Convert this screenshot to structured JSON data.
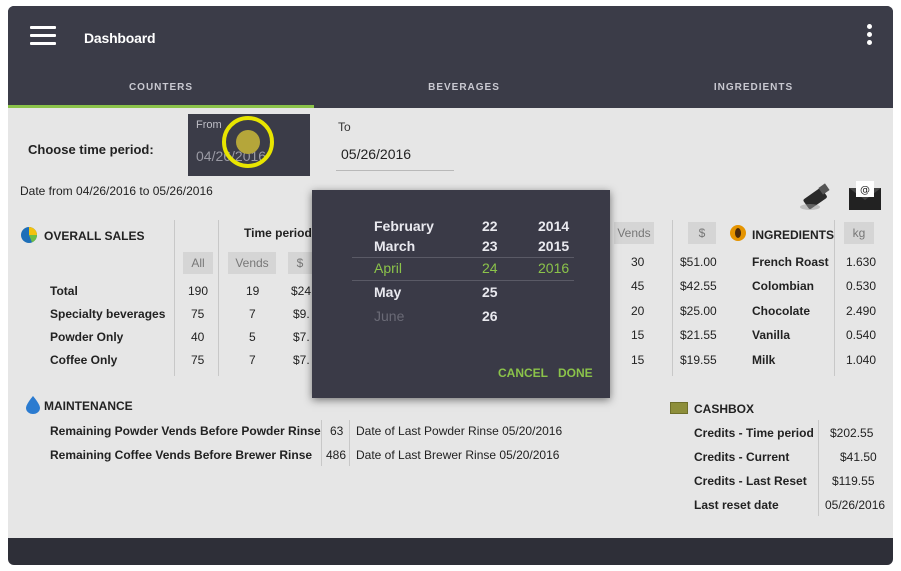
{
  "appbar": {
    "title": "Dashboard",
    "menu_icon": "hamburger-menu-icon",
    "overflow_icon": "more-vert-icon"
  },
  "tabs": [
    {
      "label": "COUNTERS",
      "active": true
    },
    {
      "label": "BEVERAGES",
      "active": false
    },
    {
      "label": "INGREDIENTS",
      "active": false
    }
  ],
  "time_period": {
    "label": "Choose time period:",
    "from_label": "From",
    "from_value": "04/26/2016",
    "to_label": "To",
    "to_value": "05/26/2016",
    "range_text": "Date from 04/26/2016 to 05/26/2016"
  },
  "colors": {
    "accent": "#8bc34a",
    "appbar": "#3b3c48",
    "touch_indicator": "#e8e500"
  },
  "sales": {
    "title": "OVERALL SALES",
    "time_period_header": "Time period",
    "col_all": "All",
    "col_vends": "Vends",
    "col_dollar": "$",
    "rows": [
      {
        "label": "Total",
        "all": "190",
        "vends": "19",
        "dollar": "$24"
      },
      {
        "label": "Specialty beverages",
        "all": "75",
        "vends": "7",
        "dollar": "$9."
      },
      {
        "label": "Powder Only",
        "all": "40",
        "vends": "5",
        "dollar": "$7."
      },
      {
        "label": "Coffee Only",
        "all": "75",
        "vends": "7",
        "dollar": "$7."
      }
    ]
  },
  "partial": {
    "col_vends": "Vends",
    "col_dollar": "$",
    "rows": [
      {
        "vends": "30",
        "dollar": "$51.00"
      },
      {
        "vends": "45",
        "dollar": "$42.55"
      },
      {
        "vends": "20",
        "dollar": "$25.00"
      },
      {
        "vends": "15",
        "dollar": "$21.55"
      },
      {
        "vends": "15",
        "dollar": "$19.55"
      }
    ]
  },
  "ingredients": {
    "title": "INGREDIENTS",
    "unit": "kg",
    "rows": [
      {
        "name": "French Roast",
        "kg": "1.630"
      },
      {
        "name": "Colombian",
        "kg": "0.530"
      },
      {
        "name": "Chocolate",
        "kg": "2.490"
      },
      {
        "name": "Vanilla",
        "kg": "0.540"
      },
      {
        "name": "Milk",
        "kg": "1.040"
      }
    ]
  },
  "maintenance": {
    "title": "MAINTENANCE",
    "rows": [
      {
        "label": "Remaining Powder Vends Before Powder Rinse",
        "value": "63",
        "note": "Date of Last Powder Rinse 05/20/2016"
      },
      {
        "label": "Remaining Coffee Vends Before Brewer Rinse",
        "value": "486",
        "note": "Date of Last Brewer Rinse 05/20/2016"
      }
    ]
  },
  "cashbox": {
    "title": "CASHBOX",
    "rows": [
      {
        "label": "Credits - Time period",
        "value": "$202.55"
      },
      {
        "label": "Credits - Current",
        "value": "$41.50"
      },
      {
        "label": "Credits - Last Reset",
        "value": "$119.55"
      },
      {
        "label": "Last reset date",
        "value": "05/26/2016"
      }
    ]
  },
  "date_picker": {
    "months": [
      "February",
      "March",
      "April",
      "May",
      "June"
    ],
    "days": [
      "22",
      "23",
      "24",
      "25",
      "26"
    ],
    "years": [
      "2014",
      "2015",
      "2016"
    ],
    "selected_month": "April",
    "selected_day": "24",
    "selected_year": "2016",
    "cancel_label": "CANCEL",
    "done_label": "DONE"
  }
}
